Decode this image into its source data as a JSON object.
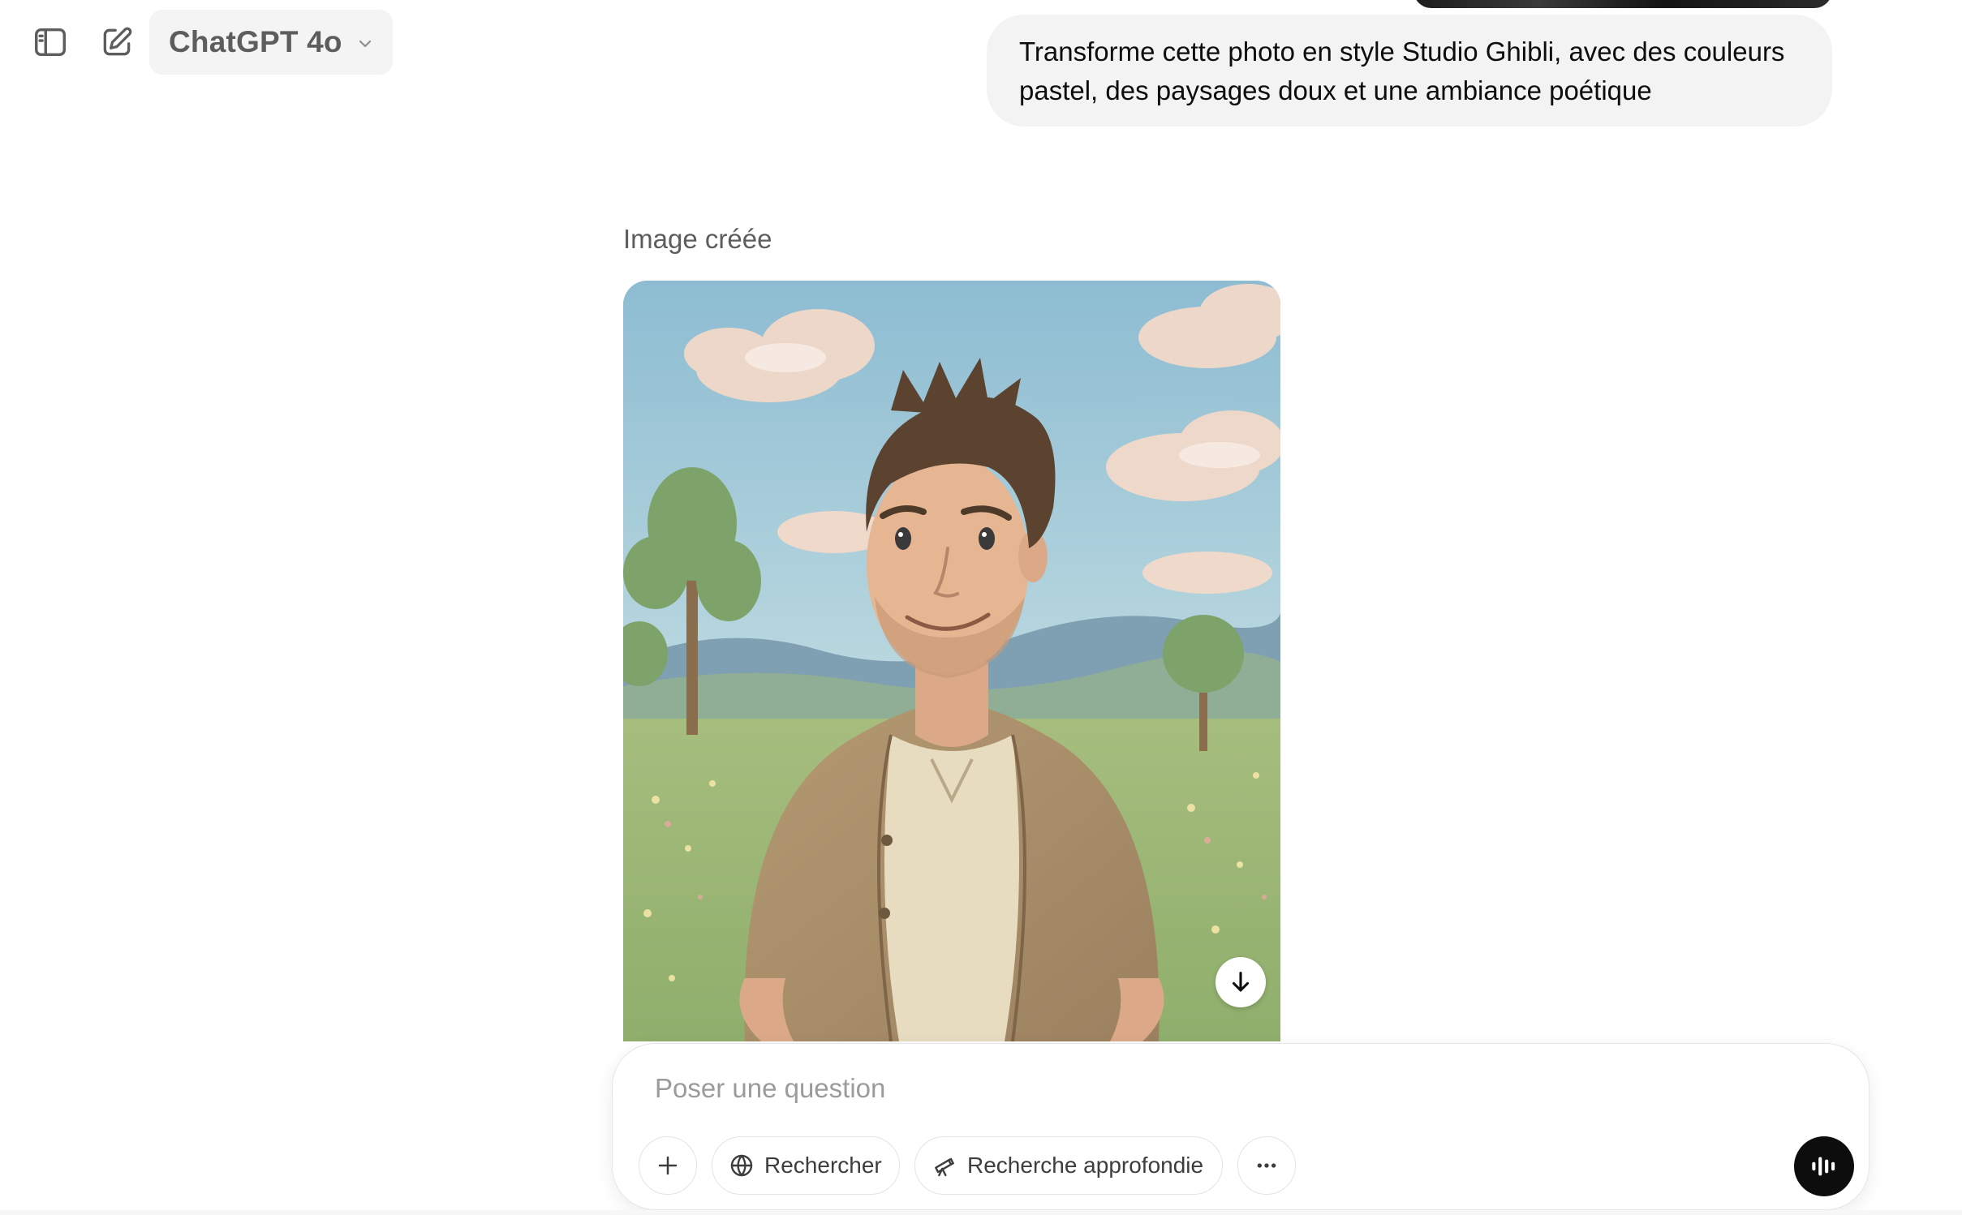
{
  "header": {
    "model_label": "ChatGPT 4o",
    "icons": {
      "sidebar_toggle": "sidebar-toggle-icon",
      "new_chat": "edit-icon",
      "model_chevron": "chevron-down-icon"
    }
  },
  "conversation": {
    "user_message": "Transforme cette photo en style Studio Ghibli, avec des couleurs pastel, des paysages doux et une ambiance poétique",
    "assistant": {
      "status_label": "Image créée",
      "image_icon_download": "arrow-down-icon"
    }
  },
  "composer": {
    "placeholder": "Poser une question",
    "value": "",
    "buttons": {
      "attach": "plus-icon",
      "search_label": "Rechercher",
      "search_icon": "globe-icon",
      "deep_research_label": "Recherche approfondie",
      "deep_research_icon": "telescope-icon",
      "more": "ellipsis-icon",
      "voice": "voice-waveform-icon"
    }
  },
  "colors": {
    "background": "#ffffff",
    "bubble": "#f3f3f3",
    "muted_text": "#5d5d5d",
    "placeholder": "#9b9b9b",
    "voice_button": "#0d0d0d"
  }
}
